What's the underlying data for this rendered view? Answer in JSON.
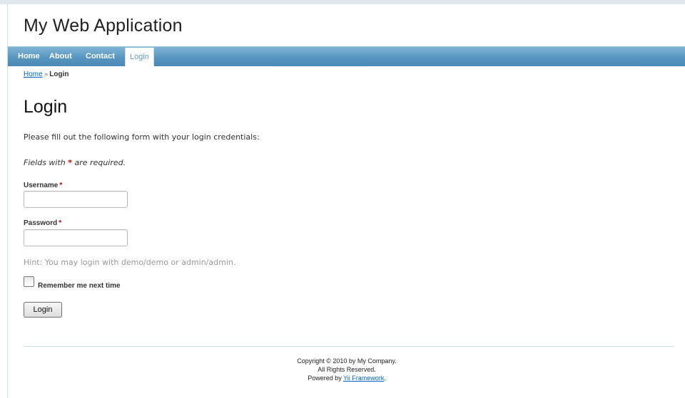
{
  "app": {
    "title": "My Web Application"
  },
  "mainmenu": {
    "items": [
      {
        "label": "Home"
      },
      {
        "label": "About"
      },
      {
        "label": "Contact"
      },
      {
        "label": "Login"
      }
    ],
    "active": "Login"
  },
  "breadcrumbs": {
    "home": "Home",
    "separator": "»",
    "current": "Login"
  },
  "page": {
    "heading": "Login",
    "intro": "Please fill out the following form with your login credentials:",
    "note_prefix": "Fields with",
    "note_star": "*",
    "note_suffix": "are required."
  },
  "form": {
    "username": {
      "label": "Username",
      "required_mark": "*",
      "value": ""
    },
    "password": {
      "label": "Password",
      "required_mark": "*",
      "value": ""
    },
    "hint": "Hint: You may login with demo/demo or admin/admin.",
    "remember_label": "Remember me next time",
    "remember_checked": false,
    "submit_label": "Login"
  },
  "footer": {
    "line1": "Copyright © 2010 by My Company.",
    "line2": "All Rights Reserved.",
    "line3_prefix": "Powered by",
    "line3_link": "Yii Framework",
    "line3_suffix": "."
  },
  "colors": {
    "menu_bar": "#5796c0",
    "link": "#0066cc",
    "required": "#cc0000"
  }
}
